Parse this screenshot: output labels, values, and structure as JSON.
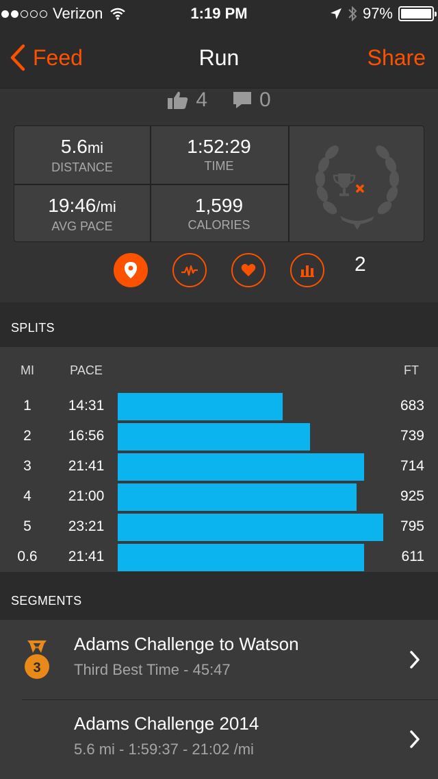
{
  "status_bar": {
    "carrier": "Verizon",
    "time": "1:19 PM",
    "battery": "97%",
    "signal_dots_filled": 2,
    "signal_dots_total": 5
  },
  "nav": {
    "back_label": "Feed",
    "title": "Run",
    "share_label": "Share"
  },
  "social": {
    "kudos": "4",
    "comments": "0"
  },
  "stats": {
    "distance_value": "5.6",
    "distance_unit": "mi",
    "distance_label": "DISTANCE",
    "time_value": "1:52:29",
    "time_label": "TIME",
    "pace_value": "19:46",
    "pace_unit": "/mi",
    "pace_label": "AVG PACE",
    "calories_value": "1,599",
    "calories_label": "CALORIES",
    "trophy_count": "2"
  },
  "tabs": {
    "icons": [
      "map-pin-icon",
      "pace-chart-icon",
      "heart-icon",
      "bar-chart-icon"
    ],
    "active": "map-pin-icon"
  },
  "splits": {
    "header": "SPLITS",
    "col_mi": "MI",
    "col_pace": "PACE",
    "col_ft": "FT",
    "rows": [
      {
        "mi": "1",
        "pace": "14:31",
        "ft": "683",
        "pace_seconds": 871
      },
      {
        "mi": "2",
        "pace": "16:56",
        "ft": "739",
        "pace_seconds": 1016
      },
      {
        "mi": "3",
        "pace": "21:41",
        "ft": "714",
        "pace_seconds": 1301
      },
      {
        "mi": "4",
        "pace": "21:00",
        "ft": "925",
        "pace_seconds": 1260
      },
      {
        "mi": "5",
        "pace": "23:21",
        "ft": "795",
        "pace_seconds": 1401
      },
      {
        "mi": "0.6",
        "pace": "21:41",
        "ft": "611",
        "pace_seconds": 1301
      }
    ]
  },
  "segments": {
    "header": "SEGMENTS",
    "items": [
      {
        "name": "Adams Challenge to Watson",
        "detail": "Third Best Time - 45:47",
        "medal": "3"
      },
      {
        "name": "Adams Challenge 2014",
        "detail": "5.6 mi - 1:59:37 - 21:02 /mi",
        "medal": ""
      }
    ]
  },
  "colors": {
    "accent": "#fc5200",
    "bar": "#0bb4ee",
    "medal": "#e8891a"
  }
}
